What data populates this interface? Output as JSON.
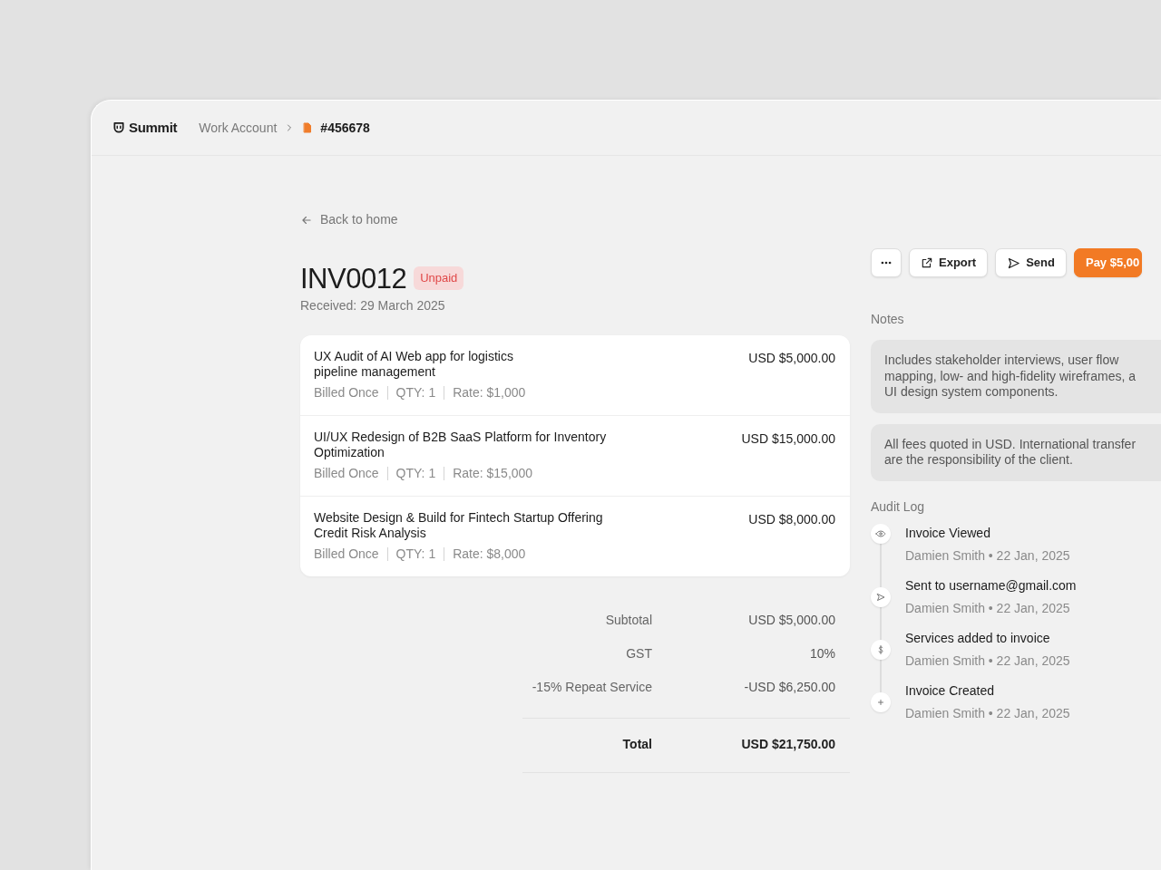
{
  "header": {
    "brand": "Summit",
    "breadcrumbs": [
      {
        "label": "Work Account",
        "kind": "link"
      },
      {
        "label": "#456678",
        "kind": "file"
      }
    ]
  },
  "back_link": "Back to home",
  "invoice": {
    "number": "INV0012",
    "status": "Unpaid",
    "received": "Received: 29 March 2025"
  },
  "actions": [
    {
      "kind": "more"
    },
    {
      "kind": "export",
      "label": "Export"
    },
    {
      "kind": "send",
      "label": "Send"
    },
    {
      "kind": "pay",
      "label": "Pay $5,00"
    }
  ],
  "items": [
    {
      "title": "UX Audit of AI Web app for logistics\npipeline management",
      "billing": "Billed Once",
      "qty": "QTY: 1",
      "rate": "Rate: $1,000",
      "amount": "USD $5,000.00"
    },
    {
      "title": "UI/UX Redesign of B2B SaaS Platform for Inventory\nOptimization",
      "billing": "Billed Once",
      "qty": "QTY: 1",
      "rate": "Rate: $15,000",
      "amount": "USD $15,000.00"
    },
    {
      "title": "Website Design & Build for Fintech Startup Offering\nCredit Risk Analysis",
      "billing": "Billed Once",
      "qty": "QTY: 1",
      "rate": "Rate: $8,000",
      "amount": "USD $8,000.00"
    }
  ],
  "totals": [
    {
      "label": "Subtotal",
      "value": "USD $5,000.00"
    },
    {
      "label": "GST",
      "value": "10%"
    },
    {
      "label": "-15% Repeat Service",
      "value": "-USD $6,250.00"
    }
  ],
  "total": {
    "label": "Total",
    "value": "USD $21,750.00"
  },
  "notes": {
    "title": "Notes",
    "entries": [
      "Includes stakeholder interviews, user flow\nmapping, low- and high-fidelity wireframes, a\nUI design system components.",
      "All fees quoted in USD. International transfer\nare the responsibility of the client."
    ]
  },
  "audit_log": {
    "title": "Audit Log",
    "entries": [
      {
        "kind": "viewed",
        "title": "Invoice Viewed",
        "meta": "Damien Smith • 22 Jan, 2025"
      },
      {
        "kind": "sent",
        "title": "Sent to username@gmail.com",
        "meta": "Damien Smith • 22 Jan, 2025"
      },
      {
        "kind": "payment",
        "title": "Services added to invoice",
        "meta": "Damien Smith • 22 Jan, 2025"
      },
      {
        "kind": "created",
        "title": "Invoice Created",
        "meta": "Damien Smith • 22 Jan, 2025"
      }
    ]
  }
}
